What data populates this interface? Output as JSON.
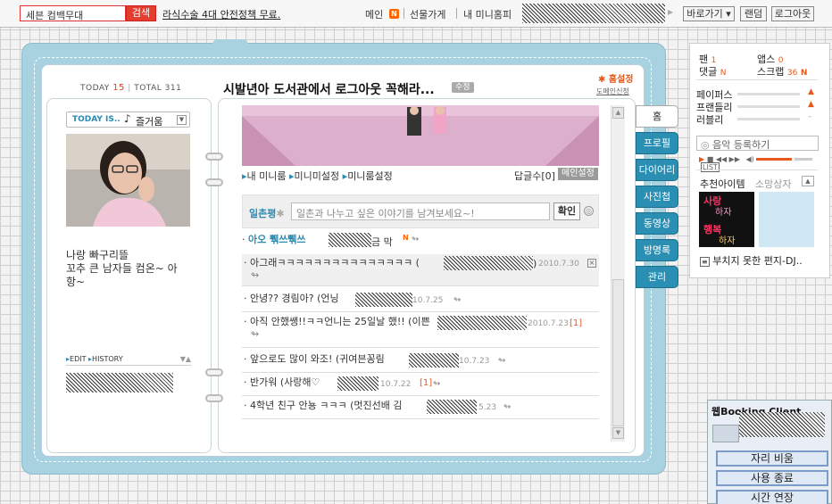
{
  "topbar": {
    "search_value": "세븐 컴백무대",
    "search_button": "검색",
    "notice": "라식수술 4대 안전정책 무료.",
    "links": [
      "메인",
      "선물가게",
      "내 미니홈피"
    ],
    "new_badge": "N",
    "buttons": [
      "바로가기 ▾",
      "랜덤",
      "로그아웃"
    ]
  },
  "header": {
    "today_label": "TODAY",
    "today_count": "15",
    "total_label": "TOTAL",
    "total_count": "311",
    "title": "시발년아 도서관에서 로그아웃 꼭해라...",
    "edit_badge": "수정",
    "home_settings": "홈설정",
    "domain_link": "도메인신청"
  },
  "profile": {
    "today_is": "TODAY IS..",
    "mood": "즐거움",
    "bio_line1": "나랑 빠구리뜰",
    "bio_line2": "꼬추 큰 남자들 컴온~ 아",
    "bio_line3": "항~",
    "edit": "EDIT",
    "history": "HISTORY"
  },
  "room": {
    "links": [
      "내 미니룸",
      "미니미설정",
      "미니룸설정"
    ],
    "reply_label": "답글수[0]",
    "main_settings": "메인설정"
  },
  "ilchon": {
    "label": "일촌평",
    "placeholder": "일촌과 나누고 싶은 이야기를 남겨보세요~!",
    "confirm": "확인"
  },
  "comments": [
    {
      "text": "아오 쀆쓰쀆쓰",
      "suffix": "금 막",
      "date": ""
    },
    {
      "text": "아그래ㅋㅋㅋㅋㅋㅋㅋㅋㅋㅋㅋㅋㅋㅋㅋ (",
      "suffix": ")",
      "date": "2010.7.30"
    },
    {
      "text": "안녕?? 경림아? (언닝",
      "suffix": "",
      "date": "10.7.25"
    },
    {
      "text": "아직 안했쌩!!ㅋㅋ언니는 25일날 했!! (이쁜",
      "suffix": "",
      "date": "2010.7.23",
      "count": "[1]"
    },
    {
      "text": "앞으로도 많이 와조! (귀여븐꽁림",
      "suffix": "",
      "date": "10.7.23"
    },
    {
      "text": "반가워 (사랑해♡",
      "suffix": "",
      "date": "10.7.22",
      "count": "[1]"
    },
    {
      "text": "4학년 친구 안뇽 ㅋㅋㅋ (멋진선배 김",
      "suffix": "",
      "date": "5.23"
    }
  ],
  "side_tabs": [
    "홈",
    "프로필",
    "다이어리",
    "사진첩",
    "동영상",
    "방명록",
    "관리"
  ],
  "stats": {
    "fan": "팬",
    "fan_n": "1",
    "app": "앱스",
    "app_n": "0",
    "reply": "댓글",
    "reply_n": "N",
    "scrap": "스크랩",
    "scrap_n": "36",
    "new_mark": "N",
    "rows": [
      "페이퍼스",
      "프랜들리",
      "러블리"
    ]
  },
  "music": {
    "register": "음악 등록하기",
    "list": "LIST"
  },
  "recommend": {
    "tab1": "추천아이템",
    "tab2": "소망상자",
    "item_text": "사랑하자 행복하자",
    "letter": "부치지 못한 편지-DJ.."
  },
  "booking": {
    "title": "웹Booking Client",
    "buttons": [
      "자리 비움",
      "사용 종료",
      "시간 연장"
    ]
  },
  "colors": {
    "accent_red": "#e53d2d",
    "tab_blue": "#2b8eb3",
    "frame": "#a8d2df",
    "orange": "#e55a1c"
  }
}
